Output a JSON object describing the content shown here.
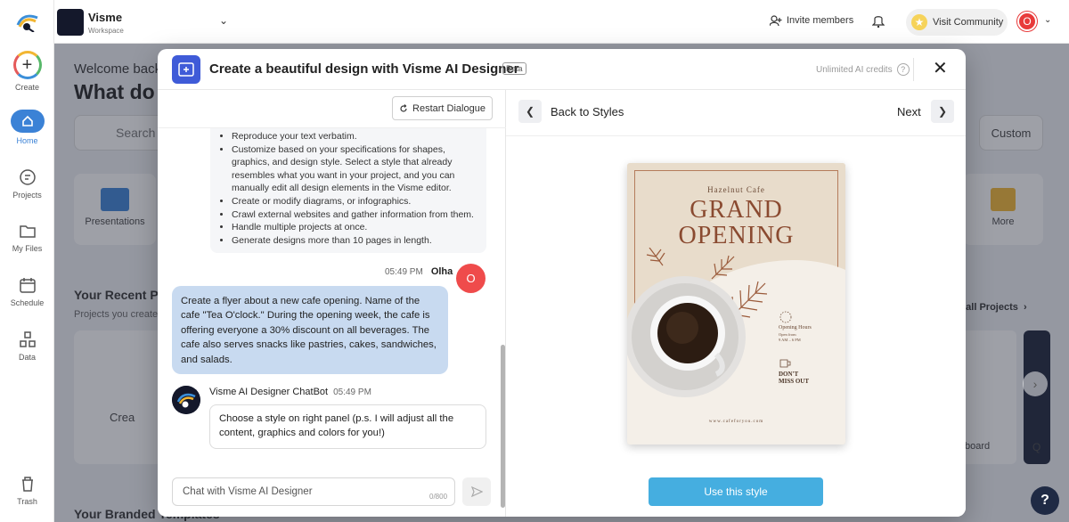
{
  "app": {
    "workspace_name": "Visme",
    "workspace_sub": "Workspace",
    "invite_label": "Invite members",
    "visit_community_label": "Visit Community",
    "user_initial": "O"
  },
  "sidebar": {
    "items": [
      {
        "label": "Create",
        "icon": "plus-icon"
      },
      {
        "label": "Home",
        "icon": "home-icon"
      },
      {
        "label": "Projects",
        "icon": "projects-icon"
      },
      {
        "label": "My Files",
        "icon": "folder-icon"
      },
      {
        "label": "Schedule",
        "icon": "calendar-icon"
      },
      {
        "label": "Data",
        "icon": "data-icon"
      },
      {
        "label": "Trash",
        "icon": "trash-icon"
      }
    ]
  },
  "background": {
    "welcome": "Welcome back",
    "headline": "What do",
    "search_placeholder": "Search",
    "custom_label": "Custom",
    "card_presentations": "Presentations",
    "card_more": "More",
    "recent_title": "Your Recent P",
    "recent_sub": "Projects you create",
    "create_tile": "Crea",
    "view_all": "v all Projects",
    "thumb_label_1": "board",
    "thumb_label_2": "Q",
    "branded_title": "Your Branded Templates"
  },
  "modal": {
    "title": "Create a beautiful design with Visme AI Designer",
    "badge": "Beta",
    "credits": "Unlimited AI credits",
    "restart_label": "Restart Dialogue",
    "capabilities": [
      "Reproduce your text verbatim.",
      "Customize based on your specifications for shapes, graphics, and design style. Select a style that already resembles what you want in your project, and you can manually edit all design elements in the Visme editor.",
      "Create or modify diagrams, or infographics.",
      "Crawl external websites and gather information from them.",
      "Handle multiple projects at once.",
      "Generate designs more than 10 pages in length."
    ],
    "user_message": {
      "time": "05:49 PM",
      "author": "Olha",
      "initial": "O",
      "text": "Create a flyer about a new cafe opening. Name of the cafe \"Tea O'clock.\" During the opening week, the cafe is offering everyone a 30% discount on all beverages. The cafe also serves snacks like pastries, cakes, sandwiches, and salads."
    },
    "bot_message": {
      "author": "Visme AI Designer ChatBot",
      "time": "05:49 PM",
      "text": "Choose a style on right panel (p.s. I will adjust all the content, graphics and colors for you!)"
    },
    "chat_placeholder": "Chat with Visme AI Designer",
    "char_counter": "0/800",
    "back_label": "Back to Styles",
    "next_label": "Next",
    "use_style_label": "Use this style",
    "flyer": {
      "cafe_name": "Hazelnut Cafe",
      "headline_1": "GRAND",
      "headline_2": "OPENING",
      "hours_title": "Opening Hours",
      "hours_from": "Open from",
      "hours_time": "9 AM – 6 PM",
      "dmo_1": "DON'T",
      "dmo_2": "MISS OUT",
      "url": "www.cafeforyou.com"
    }
  }
}
